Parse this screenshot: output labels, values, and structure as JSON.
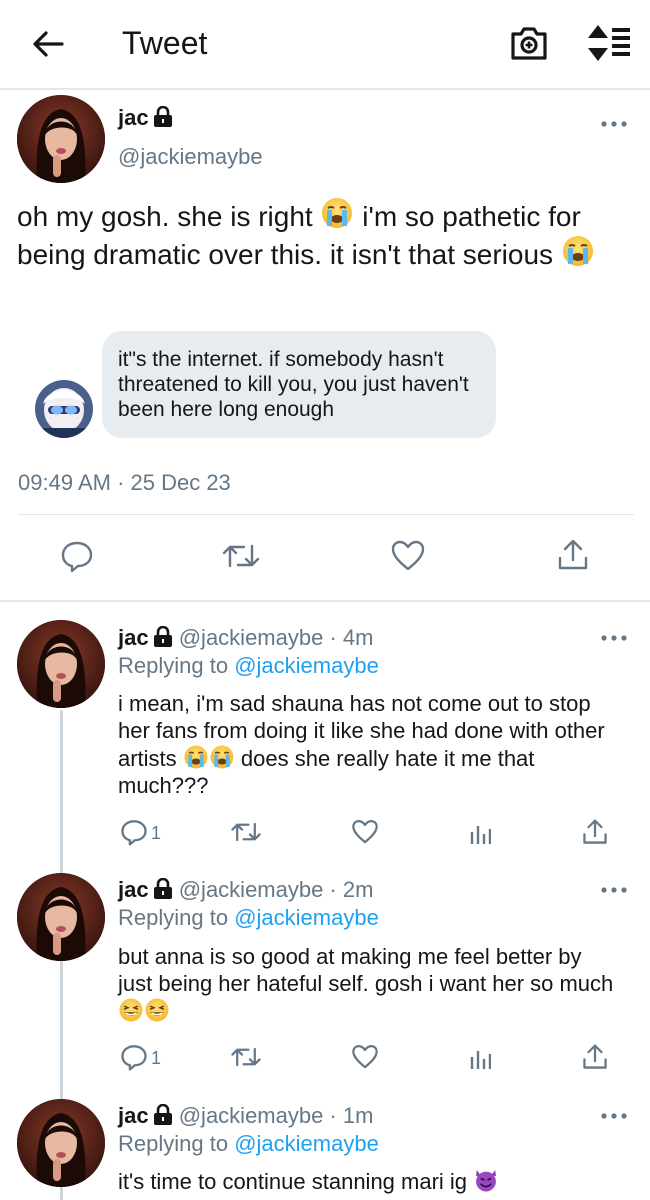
{
  "header": {
    "title": "Tweet"
  },
  "icons": {
    "back": "arrow-left-icon",
    "camera": "camera-icon",
    "sort": "sort-icon",
    "lock": "lock-icon",
    "more": "more-icon",
    "reply": "reply-icon",
    "retweet": "retweet-icon",
    "like": "heart-icon",
    "share": "share-icon",
    "analytics": "analytics-icon"
  },
  "colors": {
    "accent": "#1da1f2",
    "secondary": "#657786",
    "divider": "#e1e8ed",
    "bubble": "#e6ecf0"
  },
  "main_tweet": {
    "name": "jac",
    "handle": "@jackiemaybe",
    "text_part1": "oh my gosh. she is right ",
    "text_part2": " i'm so pathetic for being dramatic over this. it isn't that serious",
    "quote_text": "it\"s the internet. if somebody hasn't threatened to kill you, you just haven't been here long enough",
    "timestamp": "09:49 AM · 25 Dec 23"
  },
  "replies": [
    {
      "name": "jac",
      "handle": "@jackiemaybe",
      "time": " · 4m",
      "replying_prefix": "Replying to ",
      "replying_to": "@jackiemaybe",
      "text_part1": "i mean, i'm sad shauna has not come out to stop her fans from doing it like she had done with other artists ",
      "text_part2": " does she really hate it me that much???",
      "reply_count": "1"
    },
    {
      "name": "jac",
      "handle": "@jackiemaybe",
      "time": " · 2m",
      "replying_prefix": "Replying to ",
      "replying_to": "@jackiemaybe",
      "text_part1": "but anna is so good at making me feel better by just being her hateful self. gosh i want her so much ",
      "reply_count": "1"
    },
    {
      "name": "jac",
      "handle": "@jackiemaybe",
      "time": " · 1m",
      "replying_prefix": "Replying to ",
      "replying_to": "@jackiemaybe",
      "text_part1": "it's time to continue stanning mari ig "
    }
  ]
}
